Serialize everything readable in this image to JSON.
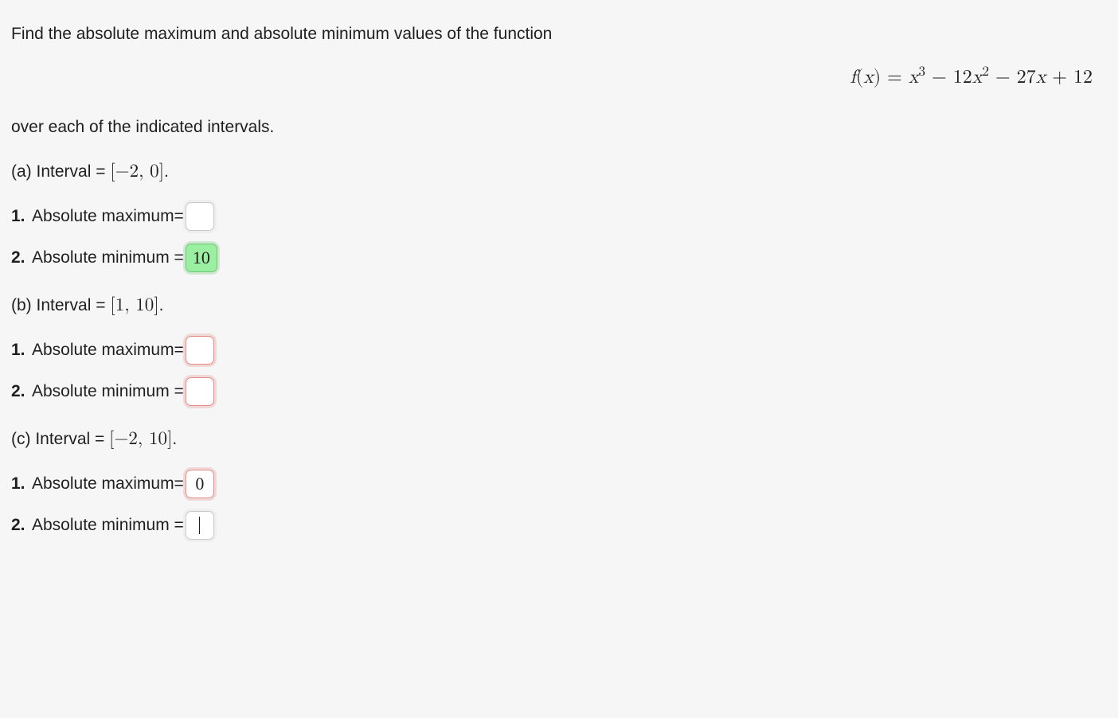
{
  "prompt": {
    "line1": "Find the absolute maximum and absolute minimum values of the function",
    "equation_html": "<span class='fx'>f</span>(<span class='fx'>x</span>) = <span class='fx'>x</span><sup>3</sup> − 12<span class='fx'>x</span><sup>2</sup> − 27<span class='fx'>x</span> + 12",
    "line2": "over each of the indicated intervals."
  },
  "parts": {
    "a": {
      "label_prefix": "(a) Interval = ",
      "interval_html": "[−2, 0]",
      "period": ".",
      "max_label": "Absolute maximum=",
      "max_value": "",
      "max_state": "neutral",
      "min_label": "Absolute minimum =",
      "min_value": "10",
      "min_state": "correct"
    },
    "b": {
      "label_prefix": "(b) Interval = ",
      "interval_html": "[1, 10]",
      "period": ".",
      "max_label": "Absolute maximum=",
      "max_value": "",
      "max_state": "wrong",
      "min_label": "Absolute minimum =",
      "min_value": "",
      "min_state": "wrong"
    },
    "c": {
      "label_prefix": "(c) Interval = ",
      "interval_html": "[−2, 10]",
      "period": ".",
      "max_label": "Absolute maximum=",
      "max_value": "0",
      "max_state": "wrong",
      "min_label": "Absolute minimum =",
      "min_value": "",
      "min_state": "neutral",
      "min_cursor": true
    }
  },
  "list_numbers": {
    "one": "1.",
    "two": "2."
  }
}
